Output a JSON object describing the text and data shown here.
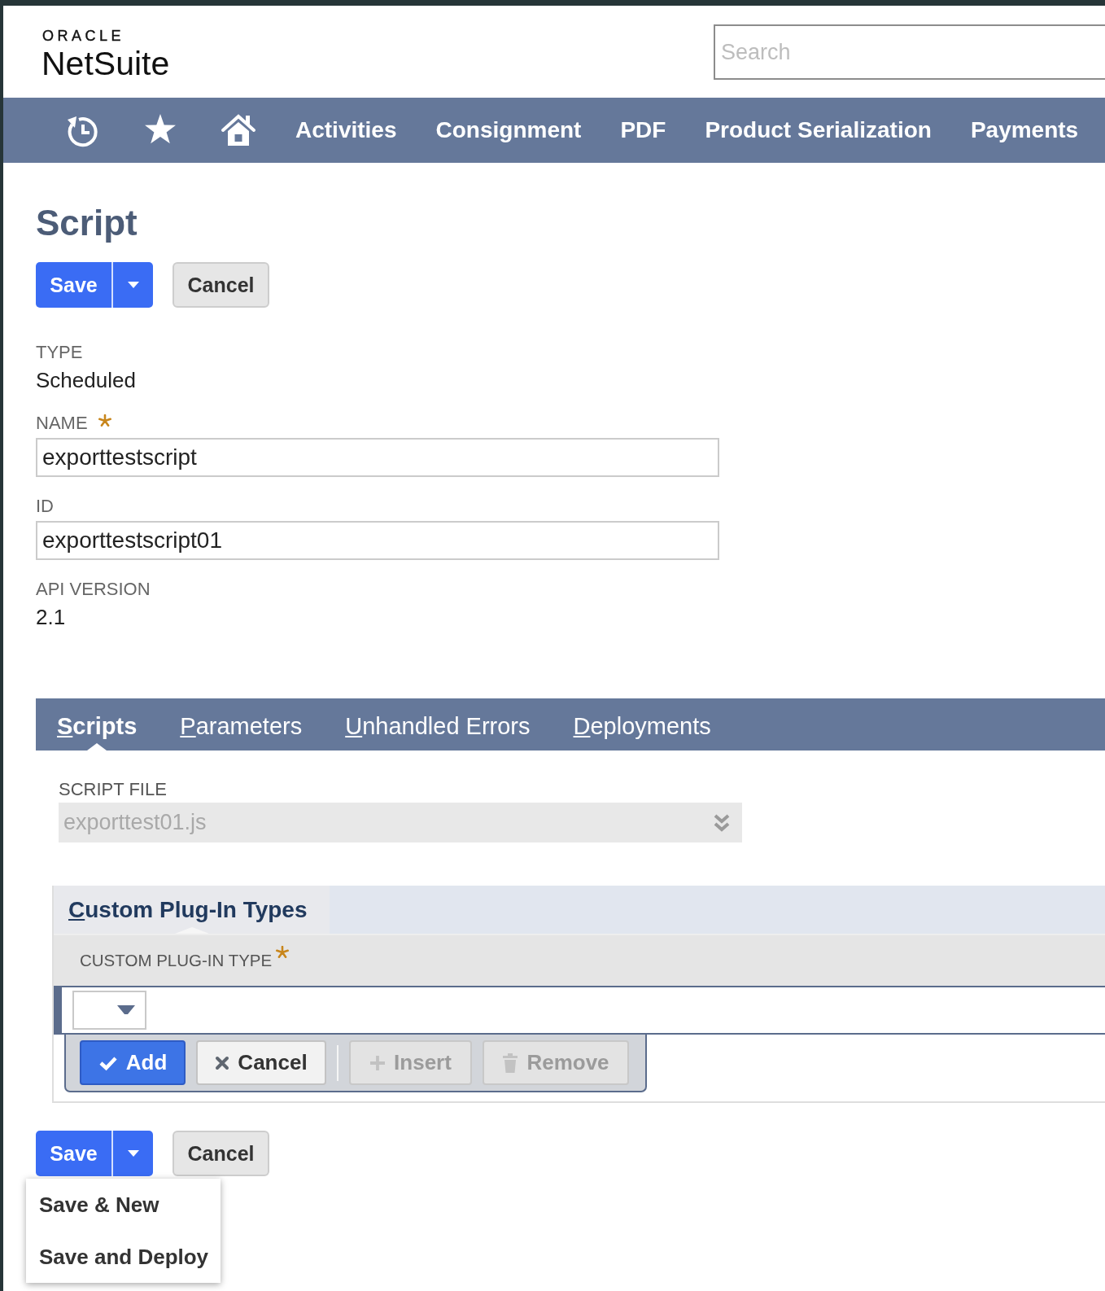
{
  "header": {
    "logo": {
      "brand": "ORACLE",
      "product": "NetSuite"
    },
    "search": {
      "placeholder": "Search"
    }
  },
  "nav": {
    "items": [
      {
        "label": "Activities"
      },
      {
        "label": "Consignment"
      },
      {
        "label": "PDF"
      },
      {
        "label": "Product Serialization"
      },
      {
        "label": "Payments"
      }
    ]
  },
  "page": {
    "title": "Script"
  },
  "top_actions": {
    "save": "Save",
    "cancel": "Cancel"
  },
  "fields": [
    {
      "kind": "static",
      "label": "TYPE",
      "required": false,
      "value": "Scheduled"
    },
    {
      "kind": "input",
      "label": "NAME",
      "required": true,
      "value": "exporttestscript"
    },
    {
      "kind": "input",
      "label": "ID",
      "required": false,
      "value": "exporttestscript01"
    },
    {
      "kind": "static",
      "label": "API VERSION",
      "required": false,
      "value": "2.1"
    }
  ],
  "tabs": [
    {
      "label": "Scripts",
      "selected": true
    },
    {
      "label": "Parameters",
      "selected": false
    },
    {
      "label": "Unhandled Errors",
      "selected": false
    },
    {
      "label": "Deployments",
      "selected": false
    }
  ],
  "script_file": {
    "label": "SCRIPT FILE",
    "value": "exporttest01.js",
    "disabled": true
  },
  "sublist": {
    "tabs": [
      {
        "label": "Custom Plug-In Types",
        "selected": true
      }
    ],
    "columns": [
      {
        "label": "CUSTOM PLUG-IN TYPE",
        "required": true
      }
    ],
    "buttons": [
      {
        "kind": "add",
        "label": "Add",
        "disabled": false
      },
      {
        "kind": "cancel",
        "label": "Cancel",
        "disabled": false
      },
      {
        "kind": "insert",
        "label": "Insert",
        "disabled": true
      },
      {
        "kind": "remove",
        "label": "Remove",
        "disabled": true
      }
    ]
  },
  "bottom_actions": {
    "save": "Save",
    "cancel": "Cancel",
    "menu": [
      {
        "label": "Save & New"
      },
      {
        "label": "Save and Deploy"
      }
    ]
  }
}
